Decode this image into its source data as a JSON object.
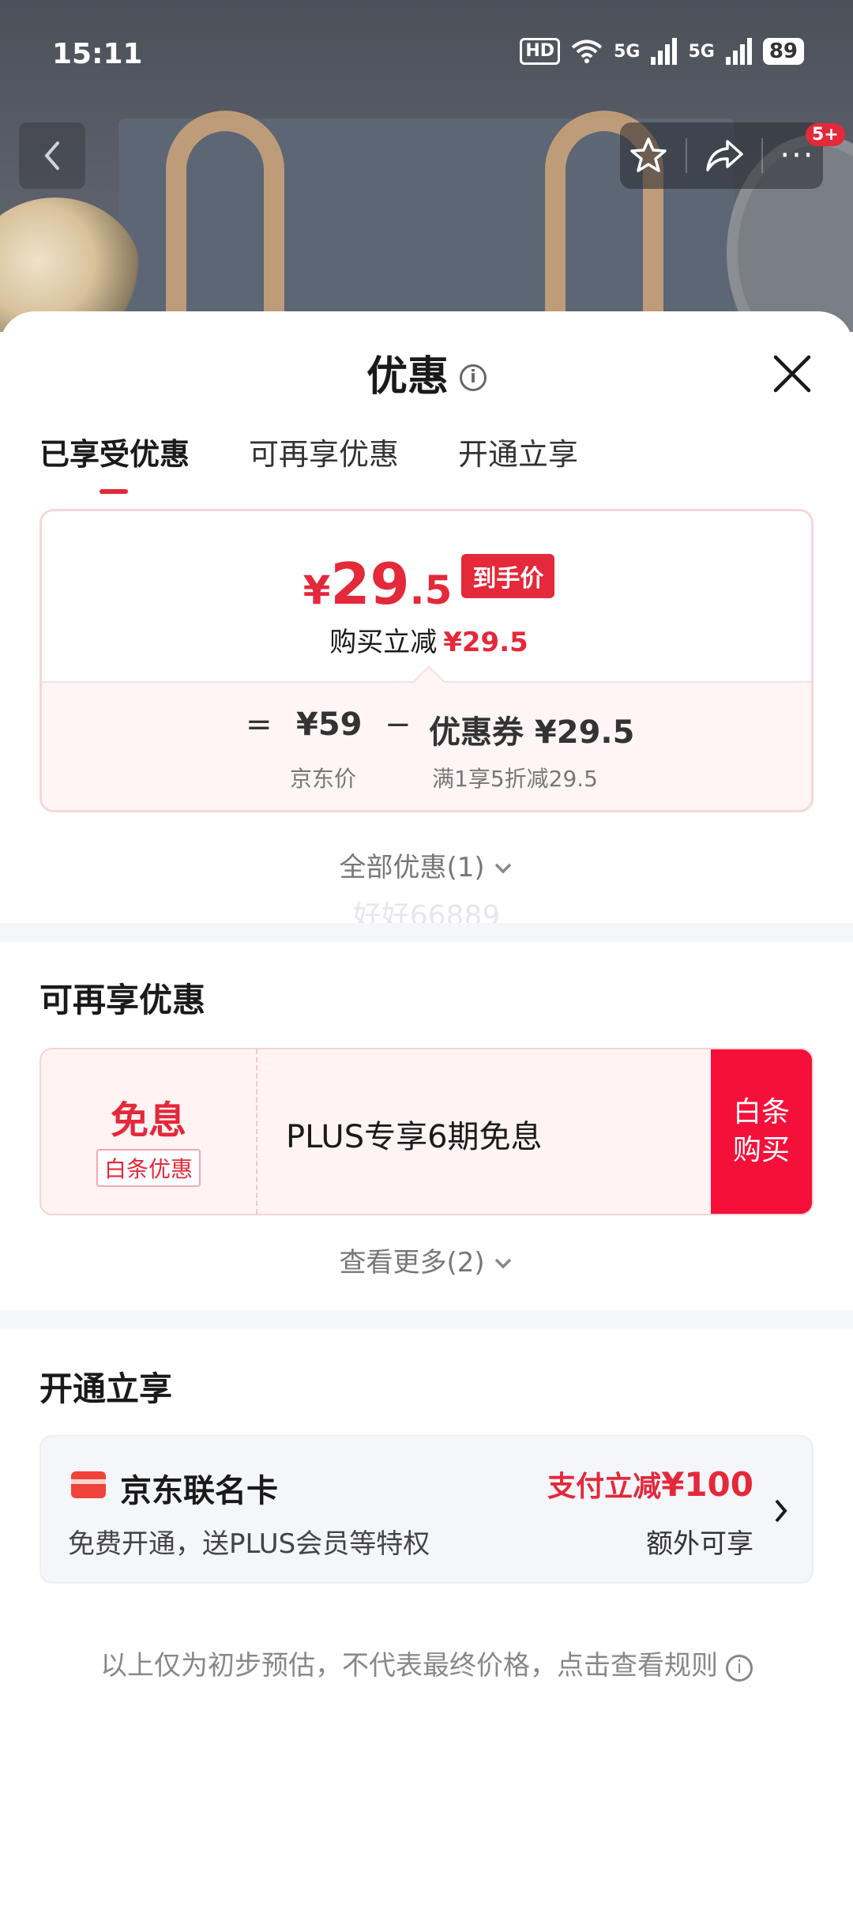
{
  "status": {
    "time": "15:11",
    "hd": "HD",
    "net1": "5G",
    "net2": "5G",
    "battery": "89"
  },
  "nav": {
    "badge": "5+",
    "more": "···"
  },
  "sheet": {
    "title": "优惠",
    "tabs": [
      "已享受优惠",
      "可再享优惠",
      "开通立享"
    ],
    "active_tab": 0
  },
  "price_card": {
    "currency": "¥",
    "price_int": "29",
    "price_dec": ".5",
    "price_tag": "到手价",
    "instant_label": "购买立减",
    "instant_value": "¥29.5",
    "eq": "=",
    "jd_price": "¥59",
    "minus": "−",
    "coupon_text": "优惠券 ¥29.5",
    "jd_price_label": "京东价",
    "coupon_label": "满1享5折减29.5"
  },
  "all_offers": "全部优惠(1)",
  "watermark": "好好66889",
  "more_offers": {
    "title": "可再享优惠",
    "coupon_big": "免息",
    "coupon_tag": "白条优惠",
    "coupon_desc": "PLUS专享6期免息",
    "coupon_btn_line1": "白条",
    "coupon_btn_line2": "购买",
    "see_more": "查看更多(2)"
  },
  "open_offers": {
    "title": "开通立享",
    "card_name": "京东联名卡",
    "card_desc": "免费开通，送PLUS会员等特权",
    "reduce_label": "支付立减",
    "reduce_amount": "¥100",
    "extra": "额外可享"
  },
  "footnote": "以上仅为初步预估，不代表最终价格，点击查看规则",
  "colors": {
    "accent": "#e3293a",
    "button_red": "#f5103a"
  }
}
